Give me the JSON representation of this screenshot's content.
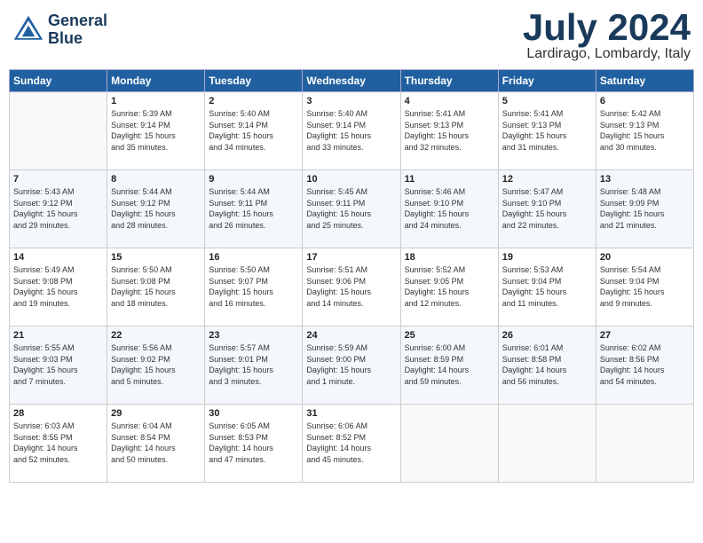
{
  "header": {
    "logo_line1": "General",
    "logo_line2": "Blue",
    "month": "July 2024",
    "location": "Lardirago, Lombardy, Italy"
  },
  "days_of_week": [
    "Sunday",
    "Monday",
    "Tuesday",
    "Wednesday",
    "Thursday",
    "Friday",
    "Saturday"
  ],
  "weeks": [
    [
      {
        "num": "",
        "info": ""
      },
      {
        "num": "1",
        "info": "Sunrise: 5:39 AM\nSunset: 9:14 PM\nDaylight: 15 hours\nand 35 minutes."
      },
      {
        "num": "2",
        "info": "Sunrise: 5:40 AM\nSunset: 9:14 PM\nDaylight: 15 hours\nand 34 minutes."
      },
      {
        "num": "3",
        "info": "Sunrise: 5:40 AM\nSunset: 9:14 PM\nDaylight: 15 hours\nand 33 minutes."
      },
      {
        "num": "4",
        "info": "Sunrise: 5:41 AM\nSunset: 9:13 PM\nDaylight: 15 hours\nand 32 minutes."
      },
      {
        "num": "5",
        "info": "Sunrise: 5:41 AM\nSunset: 9:13 PM\nDaylight: 15 hours\nand 31 minutes."
      },
      {
        "num": "6",
        "info": "Sunrise: 5:42 AM\nSunset: 9:13 PM\nDaylight: 15 hours\nand 30 minutes."
      }
    ],
    [
      {
        "num": "7",
        "info": "Sunrise: 5:43 AM\nSunset: 9:12 PM\nDaylight: 15 hours\nand 29 minutes."
      },
      {
        "num": "8",
        "info": "Sunrise: 5:44 AM\nSunset: 9:12 PM\nDaylight: 15 hours\nand 28 minutes."
      },
      {
        "num": "9",
        "info": "Sunrise: 5:44 AM\nSunset: 9:11 PM\nDaylight: 15 hours\nand 26 minutes."
      },
      {
        "num": "10",
        "info": "Sunrise: 5:45 AM\nSunset: 9:11 PM\nDaylight: 15 hours\nand 25 minutes."
      },
      {
        "num": "11",
        "info": "Sunrise: 5:46 AM\nSunset: 9:10 PM\nDaylight: 15 hours\nand 24 minutes."
      },
      {
        "num": "12",
        "info": "Sunrise: 5:47 AM\nSunset: 9:10 PM\nDaylight: 15 hours\nand 22 minutes."
      },
      {
        "num": "13",
        "info": "Sunrise: 5:48 AM\nSunset: 9:09 PM\nDaylight: 15 hours\nand 21 minutes."
      }
    ],
    [
      {
        "num": "14",
        "info": "Sunrise: 5:49 AM\nSunset: 9:08 PM\nDaylight: 15 hours\nand 19 minutes."
      },
      {
        "num": "15",
        "info": "Sunrise: 5:50 AM\nSunset: 9:08 PM\nDaylight: 15 hours\nand 18 minutes."
      },
      {
        "num": "16",
        "info": "Sunrise: 5:50 AM\nSunset: 9:07 PM\nDaylight: 15 hours\nand 16 minutes."
      },
      {
        "num": "17",
        "info": "Sunrise: 5:51 AM\nSunset: 9:06 PM\nDaylight: 15 hours\nand 14 minutes."
      },
      {
        "num": "18",
        "info": "Sunrise: 5:52 AM\nSunset: 9:05 PM\nDaylight: 15 hours\nand 12 minutes."
      },
      {
        "num": "19",
        "info": "Sunrise: 5:53 AM\nSunset: 9:04 PM\nDaylight: 15 hours\nand 11 minutes."
      },
      {
        "num": "20",
        "info": "Sunrise: 5:54 AM\nSunset: 9:04 PM\nDaylight: 15 hours\nand 9 minutes."
      }
    ],
    [
      {
        "num": "21",
        "info": "Sunrise: 5:55 AM\nSunset: 9:03 PM\nDaylight: 15 hours\nand 7 minutes."
      },
      {
        "num": "22",
        "info": "Sunrise: 5:56 AM\nSunset: 9:02 PM\nDaylight: 15 hours\nand 5 minutes."
      },
      {
        "num": "23",
        "info": "Sunrise: 5:57 AM\nSunset: 9:01 PM\nDaylight: 15 hours\nand 3 minutes."
      },
      {
        "num": "24",
        "info": "Sunrise: 5:59 AM\nSunset: 9:00 PM\nDaylight: 15 hours\nand 1 minute."
      },
      {
        "num": "25",
        "info": "Sunrise: 6:00 AM\nSunset: 8:59 PM\nDaylight: 14 hours\nand 59 minutes."
      },
      {
        "num": "26",
        "info": "Sunrise: 6:01 AM\nSunset: 8:58 PM\nDaylight: 14 hours\nand 56 minutes."
      },
      {
        "num": "27",
        "info": "Sunrise: 6:02 AM\nSunset: 8:56 PM\nDaylight: 14 hours\nand 54 minutes."
      }
    ],
    [
      {
        "num": "28",
        "info": "Sunrise: 6:03 AM\nSunset: 8:55 PM\nDaylight: 14 hours\nand 52 minutes."
      },
      {
        "num": "29",
        "info": "Sunrise: 6:04 AM\nSunset: 8:54 PM\nDaylight: 14 hours\nand 50 minutes."
      },
      {
        "num": "30",
        "info": "Sunrise: 6:05 AM\nSunset: 8:53 PM\nDaylight: 14 hours\nand 47 minutes."
      },
      {
        "num": "31",
        "info": "Sunrise: 6:06 AM\nSunset: 8:52 PM\nDaylight: 14 hours\nand 45 minutes."
      },
      {
        "num": "",
        "info": ""
      },
      {
        "num": "",
        "info": ""
      },
      {
        "num": "",
        "info": ""
      }
    ]
  ]
}
